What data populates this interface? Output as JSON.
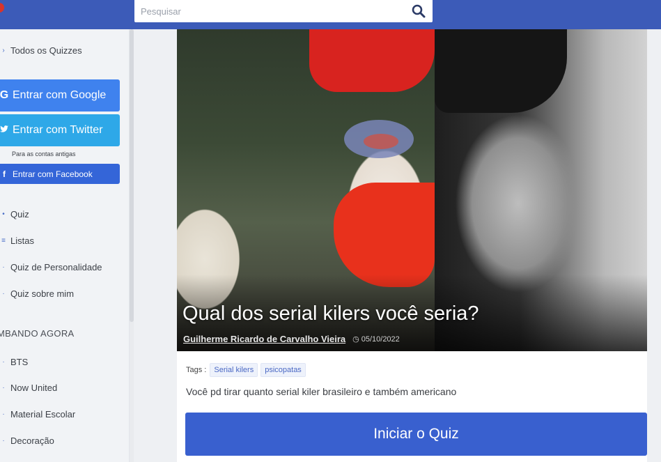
{
  "search": {
    "placeholder": "Pesquisar"
  },
  "sidebar": {
    "all_quizzes": "Todos os Quizzes",
    "login_google": "Entrar com Google",
    "login_twitter": "Entrar com Twitter",
    "old_accounts": "Para as contas antigas",
    "login_facebook": "Entrar com Facebook",
    "menu": [
      "Quiz",
      "Listas",
      "Quiz de Personalidade",
      "Quiz sobre mim"
    ],
    "trending_title": "MBANDO AGORA",
    "trending": [
      "BTS",
      "Now United",
      "Material Escolar",
      "Decoração"
    ]
  },
  "quiz": {
    "title": "Qual dos serial kilers você seria?",
    "author": "Guilherme Ricardo de Carvalho Vieira",
    "date": "05/10/2022",
    "tags_label": "Tags :",
    "tags": [
      "Serial kilers",
      "psicopatas"
    ],
    "description": "Você pd tirar quanto serial kiler brasileiro e também americano",
    "start_button": "Iniciar o Quiz"
  },
  "colors": {
    "topbar": "#3c5bb8",
    "google": "#3f82ee",
    "twitter": "#2ea8e8",
    "facebook": "#3465d8",
    "start": "#3960cf"
  },
  "icons": {
    "search": "search-icon",
    "google": "google-g-icon",
    "twitter": "twitter-bird-icon",
    "facebook": "facebook-f-icon",
    "clock": "clock-icon"
  }
}
